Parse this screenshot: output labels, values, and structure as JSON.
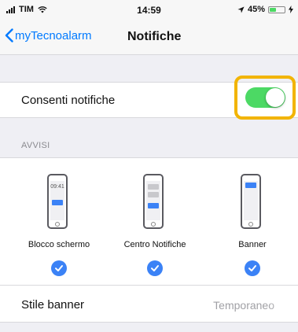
{
  "status_bar": {
    "carrier": "TIM",
    "time": "14:59",
    "battery_percent": "45%",
    "battery_level": 0.45
  },
  "nav": {
    "back_label": "myTecnoalarm",
    "title": "Notifiche"
  },
  "allow_notifications": {
    "label": "Consenti notifiche",
    "enabled": true
  },
  "alerts": {
    "header": "AVVISI",
    "items": [
      {
        "label": "Blocco schermo",
        "preview_time": "09:41",
        "checked": true
      },
      {
        "label": "Centro Notifiche",
        "checked": true
      },
      {
        "label": "Banner",
        "checked": true
      }
    ]
  },
  "banner_style": {
    "label": "Stile banner",
    "value": "Temporaneo"
  },
  "colors": {
    "accent_blue": "#007aff",
    "toggle_green": "#4cd964",
    "highlight_yellow": "#f2b400",
    "check_blue": "#3b82f6"
  }
}
